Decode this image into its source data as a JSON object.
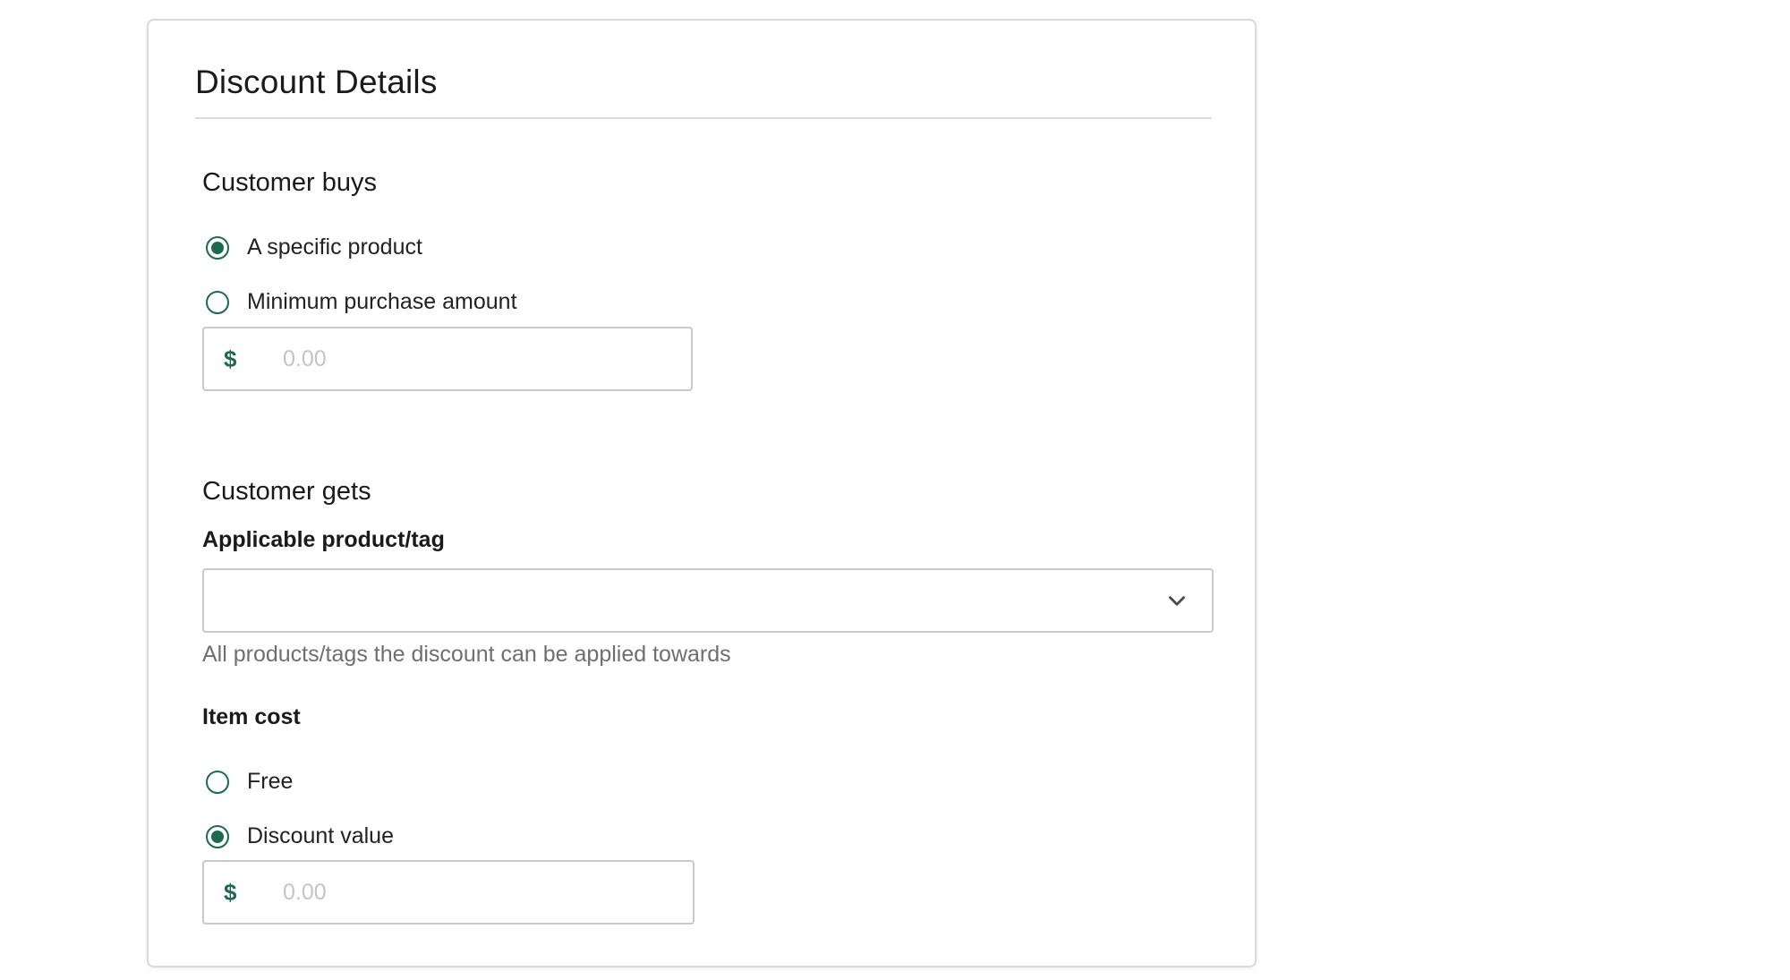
{
  "card": {
    "title": "Discount Details"
  },
  "customer_buys": {
    "title": "Customer buys",
    "options": [
      {
        "label": "A specific product",
        "selected": true
      },
      {
        "label": "Minimum purchase amount",
        "selected": false
      }
    ],
    "amount": {
      "currency_symbol": "$",
      "value": "",
      "placeholder": "0.00"
    }
  },
  "customer_gets": {
    "title": "Customer gets",
    "product_label": "Applicable product/tag",
    "product_value": "",
    "product_icon": "chevron-down-icon",
    "product_helper": "All products/tags the discount can be applied towards",
    "item_cost_label": "Item cost",
    "options": [
      {
        "label": "Free",
        "selected": false
      },
      {
        "label": "Discount value",
        "selected": true
      }
    ],
    "amount": {
      "currency_symbol": "$",
      "value": "",
      "placeholder": "0.00"
    }
  },
  "colors": {
    "accent": "#1d6a4d",
    "border": "#c9c9c9",
    "helper_text": "#6f6f6f"
  }
}
